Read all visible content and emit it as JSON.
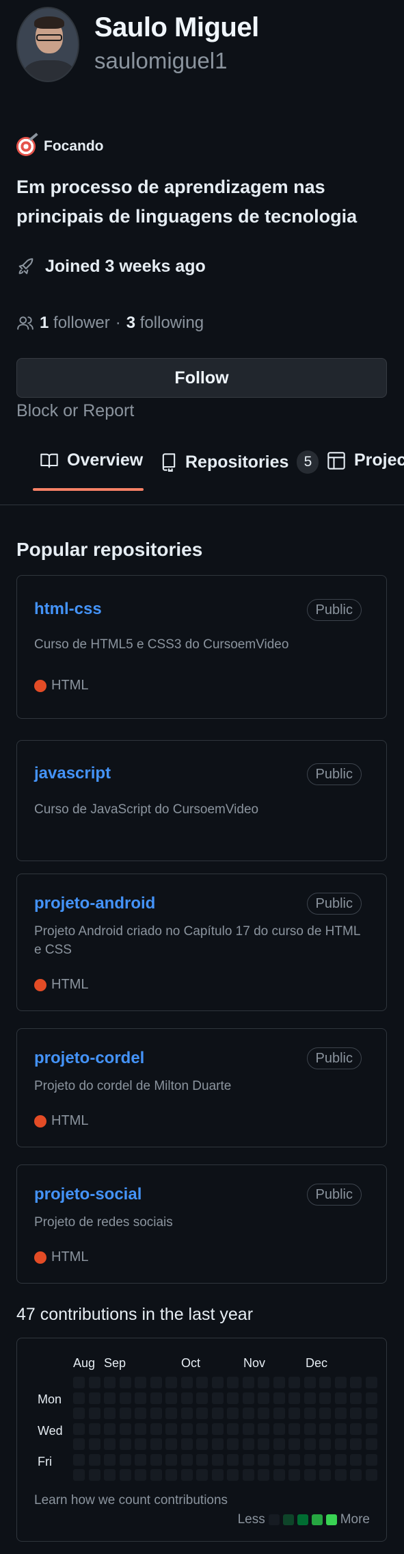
{
  "profile": {
    "name": "Saulo Miguel",
    "login": "saulomiguel1",
    "status": "Focando",
    "bio": "Em processo de aprendizagem nas principais de linguagens de tecnologia",
    "joined": "Joined 3 weeks ago",
    "followers_count": "1",
    "followers_label": "follower",
    "separator": "·",
    "following_count": "3",
    "following_label": "following",
    "follow_button": "Follow",
    "block_report": "Block or Report"
  },
  "tabs": [
    {
      "label": "Overview",
      "icon": "book-icon",
      "active": true
    },
    {
      "label": "Repositories",
      "icon": "repo-icon",
      "count": "5"
    },
    {
      "label": "Projects",
      "icon": "table-icon"
    }
  ],
  "popular": {
    "title": "Popular repositories",
    "repos": [
      {
        "name": "html-css",
        "visibility": "Public",
        "description": "Curso de HTML5 e CSS3 do CursoemVideo",
        "language": "HTML",
        "language_color": "#e34c26"
      },
      {
        "name": "javascript",
        "visibility": "Public",
        "description": "Curso de JavaScript do CursoemVideo"
      },
      {
        "name": "projeto-android",
        "visibility": "Public",
        "description": "Projeto Android criado no Capítulo 17 do curso de HTML e CSS",
        "language": "HTML",
        "language_color": "#e34c26"
      },
      {
        "name": "projeto-cordel",
        "visibility": "Public",
        "description": "Projeto do cordel de Milton Duarte",
        "language": "HTML",
        "language_color": "#e34c26"
      },
      {
        "name": "projeto-social",
        "visibility": "Public",
        "description": "Projeto de redes sociais",
        "language": "HTML",
        "language_color": "#e34c26"
      }
    ]
  },
  "contributions": {
    "title": "47 contributions in the last year",
    "months": [
      "Aug",
      "Sep",
      "Oct",
      "Nov",
      "Dec"
    ],
    "days": [
      "Mon",
      "Wed",
      "Fri"
    ],
    "learn": "Learn how we count contributions",
    "less": "Less",
    "more": "More",
    "legend_colors": [
      "#161b22",
      "#0e4429",
      "#006d32",
      "#26a641",
      "#39d353"
    ]
  }
}
